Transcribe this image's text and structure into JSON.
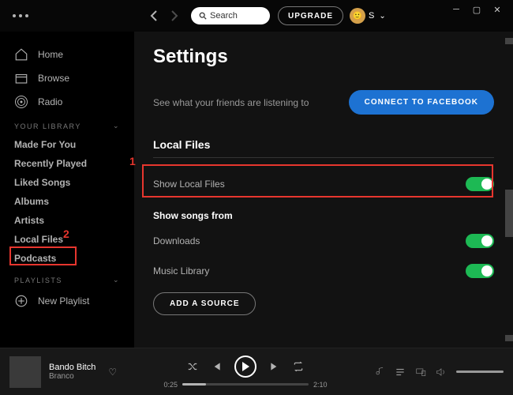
{
  "topbar": {
    "search_placeholder": "Search",
    "upgrade_label": "UPGRADE",
    "user_initial": "S"
  },
  "sidebar": {
    "home": "Home",
    "browse": "Browse",
    "radio": "Radio",
    "library_header": "YOUR LIBRARY",
    "library": [
      "Made For You",
      "Recently Played",
      "Liked Songs",
      "Albums",
      "Artists",
      "Local Files",
      "Podcasts"
    ],
    "playlists_header": "PLAYLISTS",
    "new_playlist": "New Playlist"
  },
  "settings": {
    "title": "Settings",
    "friends_text": "See what your friends are listening to",
    "connect_label": "CONNECT TO FACEBOOK",
    "local_files_header": "Local Files",
    "show_local_files": "Show Local Files",
    "show_songs_from": "Show songs from",
    "downloads": "Downloads",
    "music_library": "Music Library",
    "add_source": "ADD A SOURCE"
  },
  "player": {
    "track": "Bando Bitch",
    "artist": "Branco",
    "time_current": "0:25",
    "time_total": "2:10",
    "progress_percent": 19
  },
  "callouts": {
    "one": "1",
    "two": "2"
  }
}
